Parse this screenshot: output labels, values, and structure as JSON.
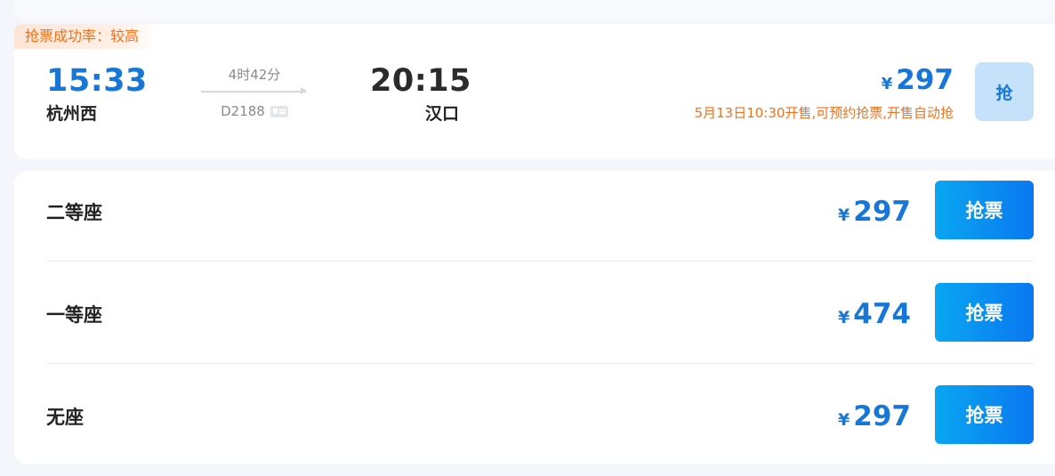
{
  "badge": "抢票成功率：较高",
  "train": {
    "departure_time": "15:33",
    "departure_station": "杭州西",
    "duration": "4时42分",
    "train_no": "D2188",
    "arrival_time": "20:15",
    "arrival_station": "汉口",
    "price_symbol": "¥",
    "min_price": "297",
    "presale_note": "5月13日10:30开售,可预约抢票,开售自动抢",
    "grab_label": "抢"
  },
  "seats": [
    {
      "name": "二等座",
      "symbol": "¥",
      "price": "297",
      "button": "抢票"
    },
    {
      "name": "一等座",
      "symbol": "¥",
      "price": "474",
      "button": "抢票"
    },
    {
      "name": "无座",
      "symbol": "¥",
      "price": "297",
      "button": "抢票"
    }
  ],
  "colors": {
    "accent": "#1677d9",
    "warning": "#f2711c",
    "button_gradient_start": "#0aa6f2",
    "button_gradient_end": "#0a78f0"
  }
}
